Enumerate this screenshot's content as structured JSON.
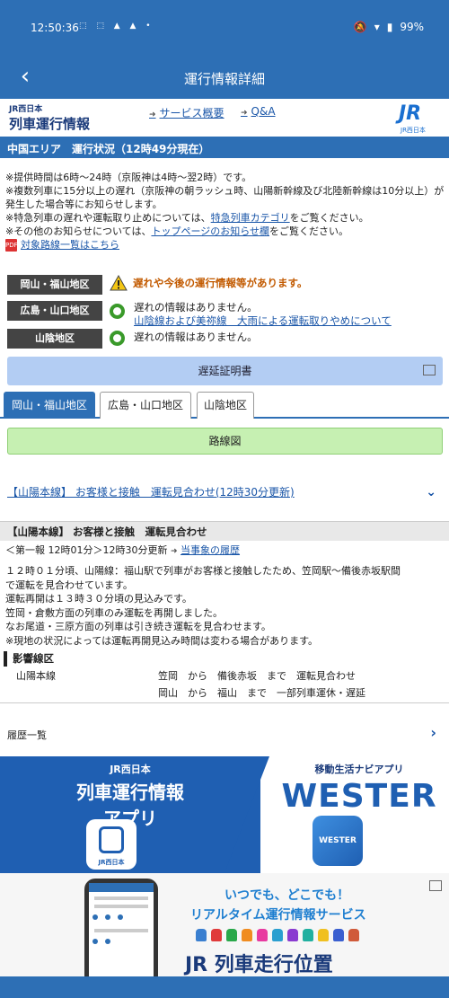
{
  "status_bar": {
    "time": "12:50:36",
    "left_icons": "⬚ ⬚ ▲ ▲ •",
    "battery": "99%"
  },
  "appbar": {
    "title": "運行情報詳細"
  },
  "site_header": {
    "brand_small": "JR西日本",
    "brand_big": "列車運行情報",
    "nav_links": [
      "サービス概要",
      "Q&A"
    ],
    "logo_text": "JR",
    "logo_sub": "JR西日本"
  },
  "area_bar": "中国エリア　運行状況（12時49分現在）",
  "notes": {
    "line1": "※提供時間は6時〜24時（京阪神は4時〜翌2時）です。",
    "line2": "※複数列車に15分以上の遅れ（京阪神の朝ラッシュ時、山陽新幹線及び北陸新幹線は10分以上）が発生した場合等にお知らせします。",
    "line3_pre": "※特急列車の遅れや運転取り止めについては、",
    "line3_link": "特急列車カテゴリ",
    "line3_post": "をご覧ください。",
    "line4_pre": "※その他のお知らせについては、",
    "line4_link": "トップページのお知らせ欄",
    "line4_post": "をご覧ください。",
    "pdf_link": "対象路線一覧はこちら",
    "pdf_icon_text": "PDF"
  },
  "regions": [
    {
      "label": "岡山・福山地区",
      "status": "遅れや今後の運行情報等があります。",
      "type": "warning"
    },
    {
      "label": "広島・山口地区",
      "status": "遅れの情報はありません。",
      "link": "山陰線および美祢線　大雨による運転取りやめについて",
      "type": "ok"
    },
    {
      "label": "山陰地区",
      "status": "遅れの情報はありません。",
      "type": "ok"
    }
  ],
  "delay_certificate": "遅延証明書",
  "tabs": [
    "岡山・福山地区",
    "広島・山口地区",
    "山陰地区"
  ],
  "route_map_button": "路線図",
  "accordion_link": "【山陽本線】 お客様と接触　運転見合わせ(12時30分更新)",
  "incident": {
    "head": "【山陽本線】 お客様と接触　運転見合わせ",
    "sub_pre": "＜第一報 12時01分＞12時30分更新",
    "sub_link": "当事象の履歴",
    "body": [
      "１２時０１分頃、山陽線：福山駅で列車がお客様と接触したため、笠岡駅〜備後赤坂駅間",
      "で運転を見合わせています。",
      "運転再開は１３時３０分頃の見込みです。",
      "笠岡・倉敷方面の列車のみ運転を再開しました。",
      "なお尾道・三原方面の列車は引き続き運転を見合わせます。",
      "※現地の状況によっては運転再開見込み時間は変わる場合があります。"
    ]
  },
  "affected": {
    "head": "影響線区",
    "line_name": "山陽本線",
    "rows": [
      "笠岡　から　備後赤坂　まで　運転見合わせ",
      "岡山　から　福山　まで　一部列車運休・遅延"
    ]
  },
  "history_label": "履歴一覧",
  "banner": {
    "left_small": "JR西日本",
    "left_title1": "列車運行情報",
    "left_title2": "アプリ",
    "app_icon_sub": "JR西日本",
    "right_small": "移動生活ナビアプリ",
    "right_title": "WESTER",
    "wester_icon_text": "WESTER"
  },
  "banner2": {
    "t1": "いつでも、どこでも！",
    "t2": "リアルタイム運行情報サービス",
    "t3": "JR 列車走行位置"
  },
  "colors": {
    "primary": "#2d6fb5",
    "warning": "#c25a00",
    "ok": "#3a9a2a",
    "link": "#1a56a8"
  }
}
